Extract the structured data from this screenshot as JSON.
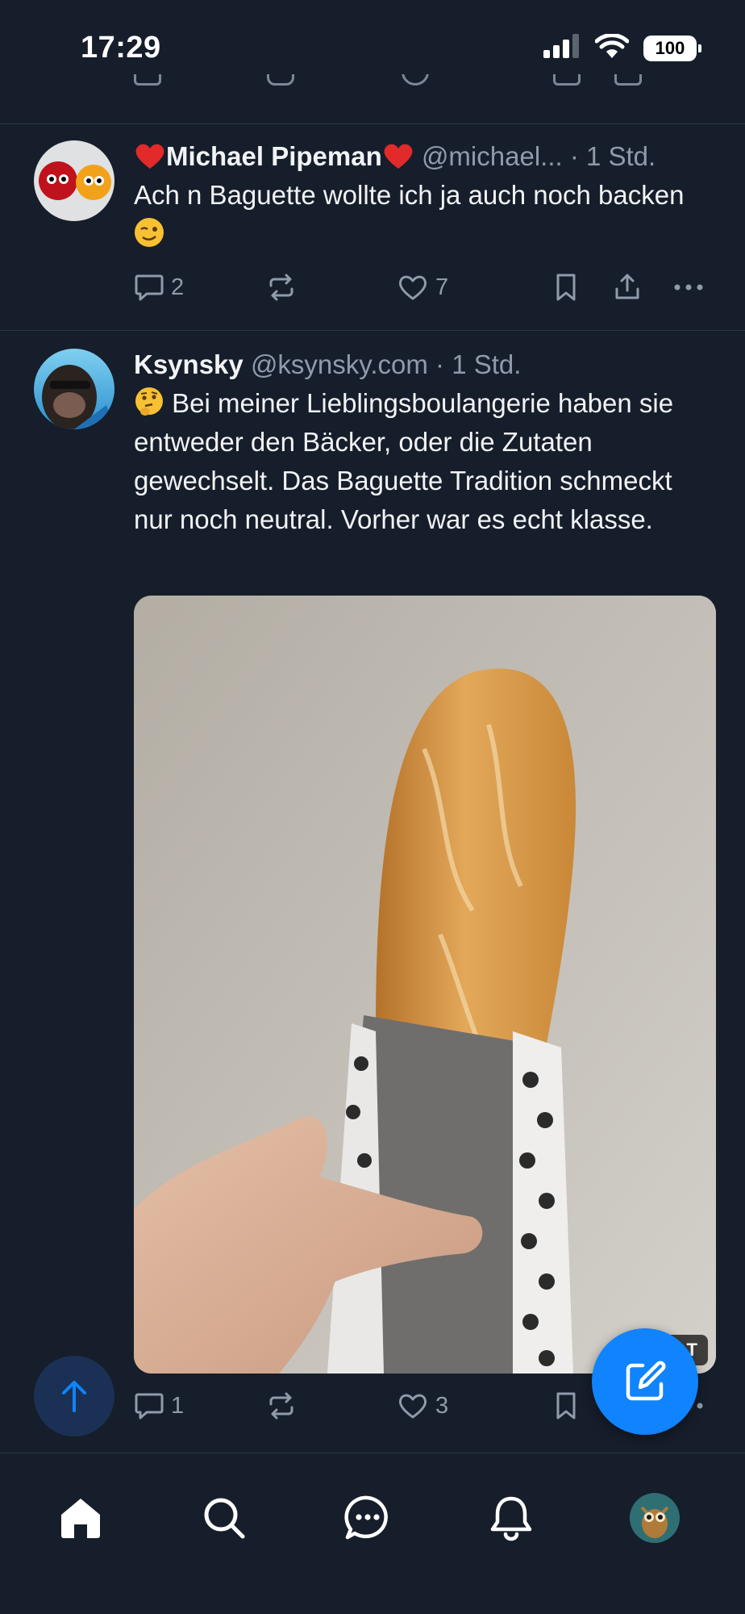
{
  "status_bar": {
    "time": "17:29",
    "battery": "100",
    "icons": [
      "signal-icon",
      "wifi-icon",
      "battery-icon"
    ]
  },
  "colors": {
    "background": "#161e2b",
    "accent": "#1083fe",
    "muted_text": "#8f9bab",
    "divider": "#2a3646"
  },
  "posts": [
    {
      "display_name_prefix_emoji": "heart",
      "display_name": "Michael Pipeman",
      "display_name_suffix_emoji": "heart",
      "handle": "@michael...",
      "time": "· 1 Std.",
      "text": "Ach n Baguette wollte ich ja auch noch backen",
      "text_emoji": "winking-face",
      "replies": "2",
      "reposts": "",
      "likes": "7"
    },
    {
      "display_name": "Ksynsky",
      "handle": "@ksynsky.com",
      "time": "· 1 Std.",
      "text_emoji": "thinking-face",
      "text": "Bei meiner Lieblingsboulangerie haben sie entweder den Bäcker, oder die Zutaten gewechselt. Das Baguette Tradition schmeckt nur noch neutral. Vorher war es echt klasse.",
      "image_badge": "ALT",
      "replies": "1",
      "reposts": "",
      "likes": "3"
    }
  ],
  "nav": {
    "items": [
      "home-icon",
      "search-icon",
      "chat-icon",
      "notifications-icon",
      "profile-avatar"
    ]
  }
}
